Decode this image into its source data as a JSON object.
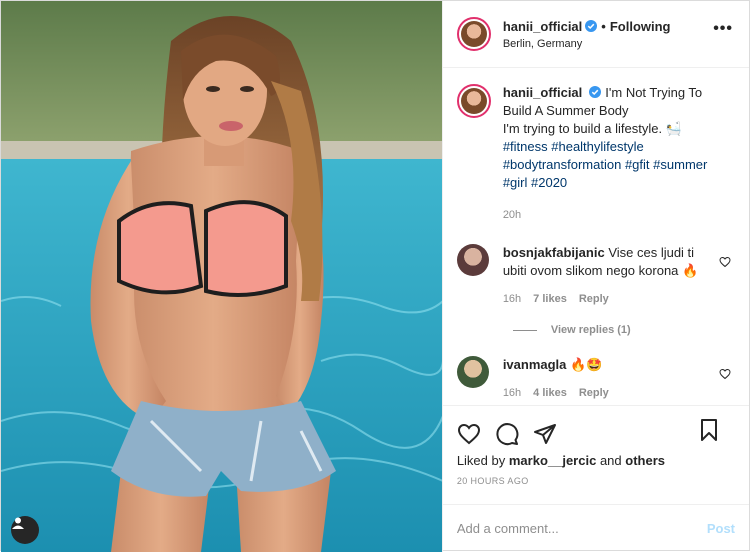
{
  "post": {
    "author": "hanii_official",
    "follow_status": "Following",
    "location": "Berlin, Germany",
    "more_label": "•••"
  },
  "caption": {
    "author": "hanii_official",
    "line1": "I'm Not Trying To Build A Summer Body",
    "line2": "I'm trying to build a lifestyle. 🛀",
    "hashtags": [
      "#fitness",
      "#healthylifestyle",
      "#bodytransformation",
      "#gfit",
      "#summer",
      "#girl",
      "#2020"
    ],
    "time": "20h"
  },
  "comments": [
    {
      "author": "bosnjakfabijanic",
      "text": "Vise ces ljudi ti ubiti ovom slikom nego korona 🔥",
      "time": "16h",
      "likes": "7 likes",
      "reply": "Reply",
      "view_replies": "View replies (1)"
    },
    {
      "author": "ivanmagla",
      "text": "🔥🤩",
      "time": "16h",
      "likes": "4 likes",
      "reply": "Reply"
    }
  ],
  "engagement": {
    "liked_by_prefix": "Liked by",
    "liked_by_user": "marko__jercic",
    "liked_by_and": "and",
    "liked_by_others": "others",
    "posted_time": "20 HOURS AGO"
  },
  "composer": {
    "placeholder": "Add a comment...",
    "post_label": "Post"
  },
  "colors": {
    "pool": "#2aa8c4",
    "link": "#00376b",
    "post_button": "#b2dffc",
    "verified": "#3897f0"
  }
}
